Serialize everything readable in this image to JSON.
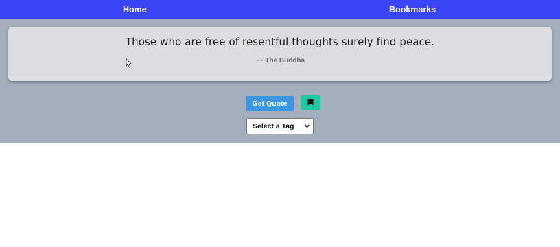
{
  "nav": {
    "home_label": "Home",
    "bookmarks_label": "Bookmarks",
    "background": "#3a45f7"
  },
  "quote": {
    "text": "Those who are free of resentful thoughts surely find peace.",
    "author": "~~ The Buddha"
  },
  "actions": {
    "get_quote_label": "Get Quote",
    "get_quote_color": "#3d97e0",
    "bookmark_icon": "bookmark-icon",
    "bookmark_color": "#22c7a0"
  },
  "tag_filter": {
    "selected": "Select a Tag",
    "icon": "chevron-down-icon"
  },
  "theme": {
    "main_background": "#a4aebc",
    "card_background": "#dcdde1"
  }
}
